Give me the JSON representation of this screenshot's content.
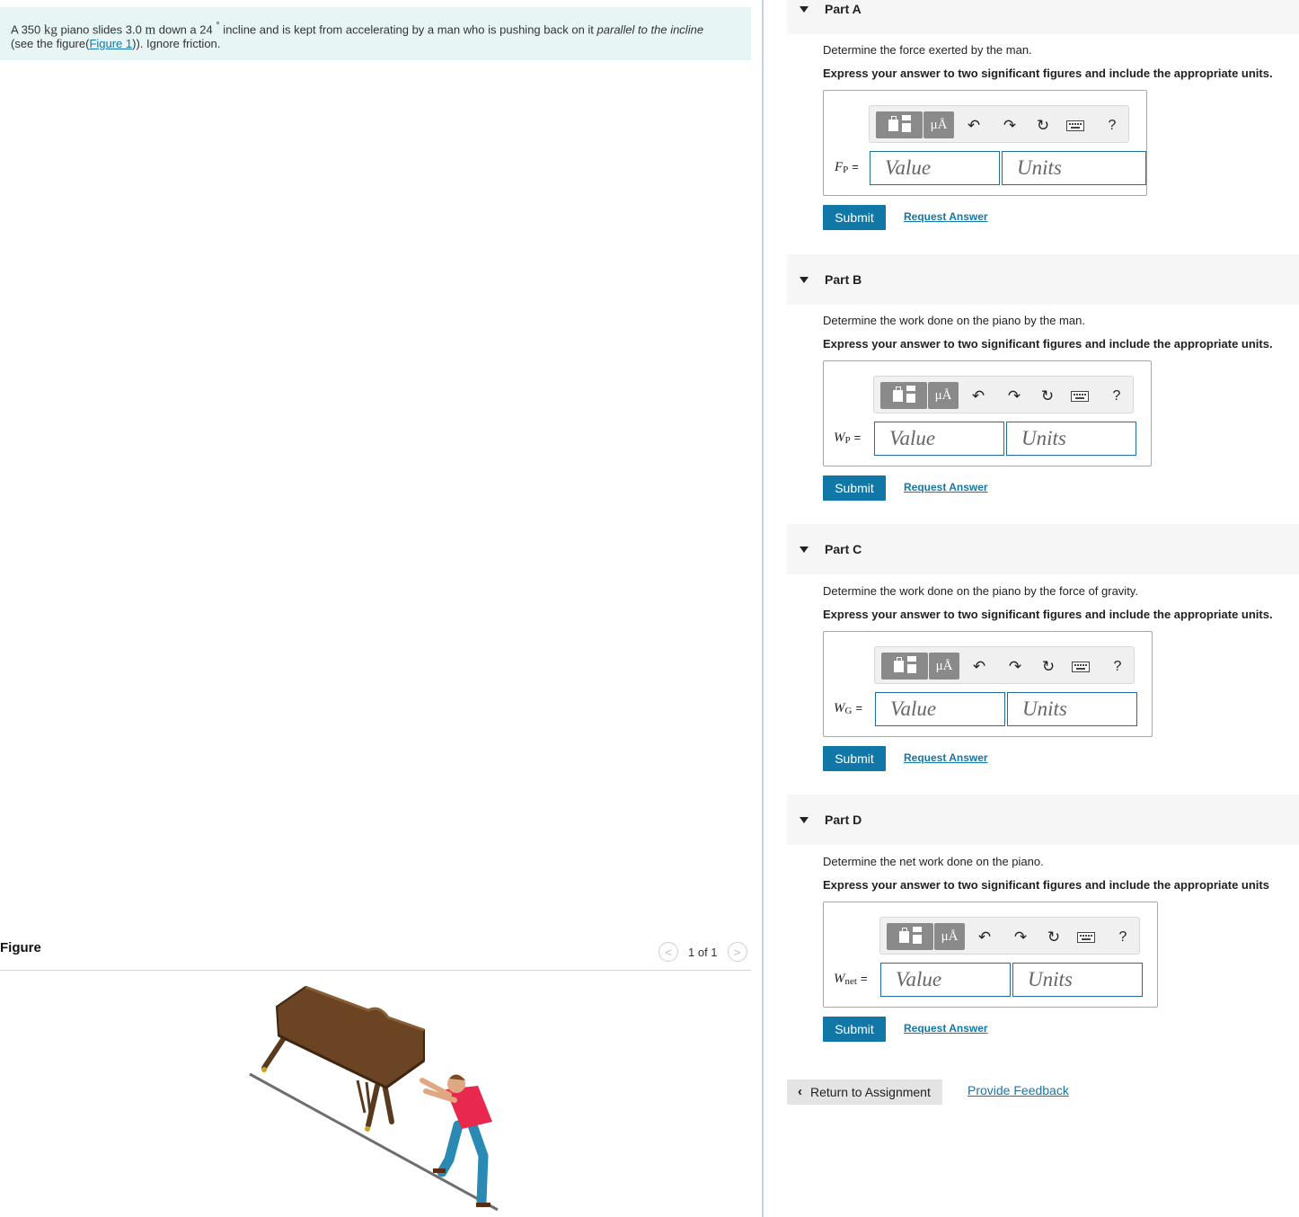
{
  "problem": {
    "t1": "A 350 ",
    "u1": "kg",
    "t2": " piano slides 3.0 ",
    "u2": "m",
    "t3": " down a 24 ",
    "deg": "°",
    "t4": " incline and is kept from accelerating by a man who is pushing back on it ",
    "italic": "parallel to the incline",
    "t5": "(see the figure(",
    "link": "Figure 1",
    "t6": ")). Ignore friction."
  },
  "figure": {
    "label": "Figure",
    "prev": "<",
    "count": "1 of 1",
    "next": ">"
  },
  "toolbar": {
    "mu": "μÅ",
    "undo": "↶",
    "redo": "↷",
    "reset": "↻",
    "help": "?"
  },
  "parts": [
    {
      "title": "Part A",
      "question": "Determine the force exerted by the man.",
      "instruction": "Express your answer to two significant figures and include the appropriate units.",
      "var": "F",
      "sub": "P",
      "eq": "=",
      "value_placeholder": "Value",
      "units_placeholder": "Units",
      "submit": "Submit",
      "request": "Request Answer"
    },
    {
      "title": "Part B",
      "question": "Determine the work done on the piano by the man.",
      "instruction": "Express your answer to two significant figures and include the appropriate units.",
      "var": "W",
      "sub": "P",
      "eq": "=",
      "value_placeholder": "Value",
      "units_placeholder": "Units",
      "submit": "Submit",
      "request": "Request Answer"
    },
    {
      "title": "Part C",
      "question": "Determine the work done on the piano by the force of gravity.",
      "instruction": "Express your answer to two significant figures and include the appropriate units.",
      "var": "W",
      "sub": "G",
      "eq": "=",
      "value_placeholder": "Value",
      "units_placeholder": "Units",
      "submit": "Submit",
      "request": "Request Answer"
    },
    {
      "title": "Part D",
      "question": "Determine the net work done on the piano.",
      "instruction": "Express your answer to two significant figures and include the appropriate units",
      "var": "W",
      "sub": "net",
      "eq": "=",
      "value_placeholder": "Value",
      "units_placeholder": "Units",
      "submit": "Submit",
      "request": "Request Answer"
    }
  ],
  "footer": {
    "return": "Return to Assignment",
    "feedback": "Provide Feedback"
  },
  "colors": {
    "accent": "#1177a6",
    "link": "#1477a8",
    "problem_bg": "#e8f5f5",
    "input_border": "#1f6f9a"
  }
}
